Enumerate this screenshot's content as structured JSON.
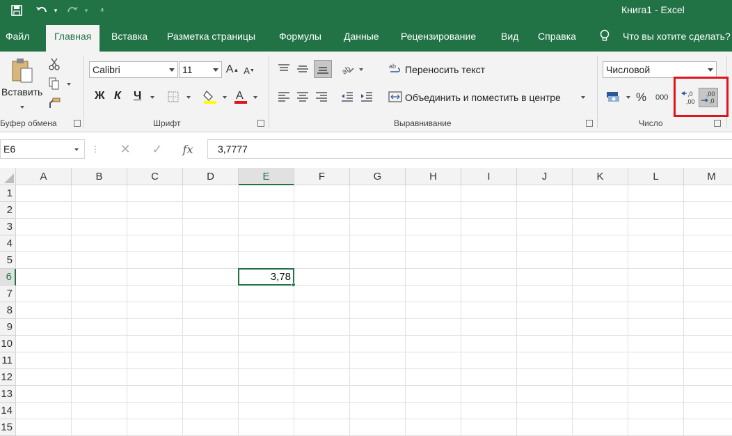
{
  "window": {
    "title": "Книга1  -  Excel"
  },
  "tabs": [
    {
      "label": "Файл"
    },
    {
      "label": "Главная"
    },
    {
      "label": "Вставка"
    },
    {
      "label": "Разметка страницы"
    },
    {
      "label": "Формулы"
    },
    {
      "label": "Данные"
    },
    {
      "label": "Рецензирование"
    },
    {
      "label": "Вид"
    },
    {
      "label": "Справка"
    }
  ],
  "tell_me": "Что вы хотите сделать?",
  "ribbon": {
    "clipboard": {
      "paste_label": "Вставить",
      "group_label": "Буфер обмена"
    },
    "font": {
      "family": "Calibri",
      "size": "11",
      "bold": "Ж",
      "italic": "К",
      "underline": "Ч",
      "group_label": "Шрифт"
    },
    "alignment": {
      "wrap_text": "Переносить текст",
      "merge_center": "Объединить и поместить в центре",
      "group_label": "Выравнивание"
    },
    "number": {
      "format": "Числовой",
      "percent": "%",
      "thousands": "000",
      "increase_decimal": ",0\n,00",
      "decrease_decimal": ",00\n→,0",
      "group_label": "Число"
    }
  },
  "formula_bar": {
    "name_box": "E6",
    "fx": "fx",
    "value": "3,7777"
  },
  "grid": {
    "columns": [
      "A",
      "B",
      "C",
      "D",
      "E",
      "F",
      "G",
      "H",
      "I",
      "J",
      "K",
      "L",
      "M"
    ],
    "rows": [
      "1",
      "2",
      "3",
      "4",
      "5",
      "6",
      "7",
      "8",
      "9",
      "10",
      "11",
      "12",
      "13",
      "14",
      "15"
    ],
    "selected_column": "E",
    "selected_row": "6",
    "active_cell": {
      "ref": "E6",
      "display": "3,78"
    }
  },
  "colors": {
    "accent": "#217346",
    "highlight": "#e0141e"
  }
}
